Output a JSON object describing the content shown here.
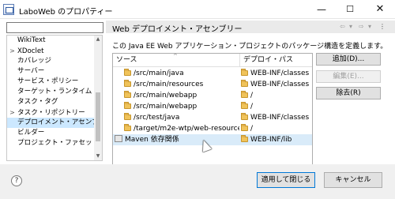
{
  "window": {
    "title": "LaboWeb のプロパティー",
    "minimize": "—",
    "maximize": "☐",
    "close": "✕"
  },
  "sidebar": {
    "filter_value": "",
    "items": [
      {
        "label": "WikiText",
        "arrow": ""
      },
      {
        "label": "XDoclet",
        "arrow": ">"
      },
      {
        "label": "カバレッジ",
        "arrow": ""
      },
      {
        "label": "サーバー",
        "arrow": ""
      },
      {
        "label": "サービス・ポリシー",
        "arrow": ""
      },
      {
        "label": "ターゲット・ランタイム",
        "arrow": ""
      },
      {
        "label": "タスク・タグ",
        "arrow": ""
      },
      {
        "label": "タスク・リポジトリー",
        "arrow": ">"
      },
      {
        "label": "デプロイメント・アセンブリー",
        "arrow": "",
        "selected": true
      },
      {
        "label": "ビルダー",
        "arrow": ""
      },
      {
        "label": "プロジェクト・ファセット",
        "arrow": ""
      }
    ]
  },
  "header": {
    "title": "Web デプロイメント・アセンブリー",
    "nav_back": "⇦",
    "nav_back_menu": "▾",
    "nav_forward": "⇨",
    "nav_forward_menu": "▾",
    "nav_menu": "⋮"
  },
  "description": "この Java EE Web アプリケーション・プロジェクトのパッケージ構造を定義します。",
  "table": {
    "columns": [
      "ソース",
      "デプロイ・パス"
    ],
    "sort_indicator": "^",
    "rows": [
      {
        "source": "/src/main/java",
        "deploy": "WEB-INF/classes",
        "icon": "folder-icon"
      },
      {
        "source": "/src/main/resources",
        "deploy": "WEB-INF/classes",
        "icon": "folder-icon"
      },
      {
        "source": "/src/main/webapp",
        "deploy": "/",
        "icon": "folder-icon"
      },
      {
        "source": "/src/main/webapp",
        "deploy": "/",
        "icon": "folder-icon"
      },
      {
        "source": "/src/test/java",
        "deploy": "WEB-INF/classes",
        "icon": "folder-icon"
      },
      {
        "source": "/target/m2e-wtp/web-resources",
        "deploy": "/",
        "icon": "folder-icon"
      },
      {
        "source": "Maven 依存関係",
        "deploy": "WEB-INF/lib",
        "icon": "library-icon",
        "selected": true
      }
    ]
  },
  "buttons": {
    "add": "追加(D)...",
    "edit": "編集(E)...",
    "remove": "除去(R)",
    "help": "?",
    "apply_close": "適用して閉じる",
    "cancel": "キャンセル"
  },
  "colors": {
    "selection": "#cce8ff",
    "row_selection": "#d9ebf9",
    "default_button_border": "#0078d7",
    "folder": "#f0c35a"
  }
}
